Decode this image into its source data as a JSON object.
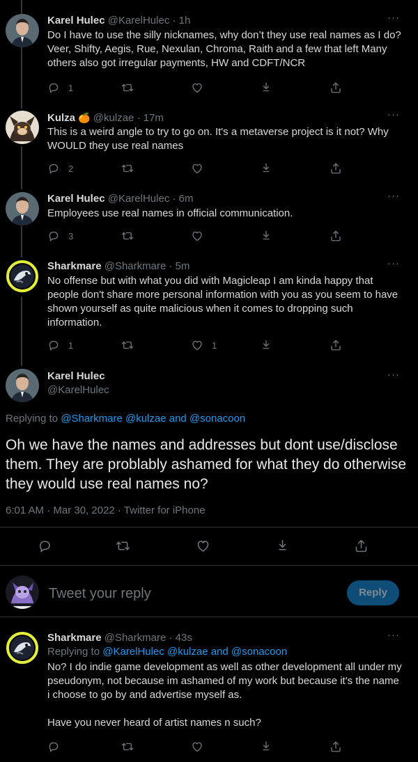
{
  "tweets": [
    {
      "name": "Karel Hulec",
      "handle": "@KarelHulec",
      "time": "· 1h",
      "text": "Do I have to use the silly nicknames, why don’t they use real names as I do? Veer, Shifty, Aegis, Rue, Nexulan, Chroma, Raith and a few that left Many others also got irregular payments, HW and CDFT/NCR",
      "replies": "1",
      "retweets": "",
      "likes": ""
    },
    {
      "name": "Kulza",
      "badge": "🍊",
      "handle": "@kulzae",
      "time": "· 17m",
      "text": "This is a weird angle to try to go on. It's a metaverse project is it not? Why WOULD they use real names",
      "replies": "2",
      "retweets": "",
      "likes": ""
    },
    {
      "name": "Karel Hulec",
      "handle": "@KarelHulec",
      "time": "· 6m",
      "text": "Employees use real names in official communication.",
      "replies": "3",
      "retweets": "",
      "likes": ""
    },
    {
      "name": "Sharkmare",
      "handle": "@Sharkmare",
      "time": "· 5m",
      "text": "No offense but with what you did with Magicleap I am kinda happy that people don't share more personal information with you as you seem to have shown yourself as quite malicious when it comes to dropping such information.",
      "replies": "1",
      "retweets": "",
      "likes": "1"
    }
  ],
  "focus": {
    "name": "Karel Hulec",
    "handle": "@KarelHulec",
    "replying_prefix": "Replying to",
    "replying_to": "@Sharkmare @kulzae and @sonacoon",
    "text": "Oh we have the names and addresses but dont use/disclose them. They are problably ashamed for what they do otherwise they would use real names no?",
    "timestamp": "6:01 AM · Mar 30, 2022 · Twitter for iPhone"
  },
  "compose": {
    "placeholder": "Tweet your reply",
    "reply_label": "Reply"
  },
  "last_reply": {
    "name": "Sharkmare",
    "handle": "@Sharkmare",
    "time": "· 43s",
    "replying_prefix": "Replying to",
    "replying_to": "@KarelHulec @kulzae and @sonacoon",
    "text": "No? I do indie game development as well as other development all under my pseudonym, not because im ashamed of my work but because it's the name i choose to go by and advertise myself as.\n\nHave you never heard of artist names n such?"
  },
  "icons": {
    "more": "more-icon",
    "reply": "reply-icon",
    "retweet": "retweet-icon",
    "like": "like-icon",
    "save": "bookmark-icon",
    "share": "share-icon"
  },
  "colors": {
    "accent": "#1d9bf0",
    "muted": "#6e767d",
    "text": "#d9d9d9",
    "background": "#000000"
  }
}
